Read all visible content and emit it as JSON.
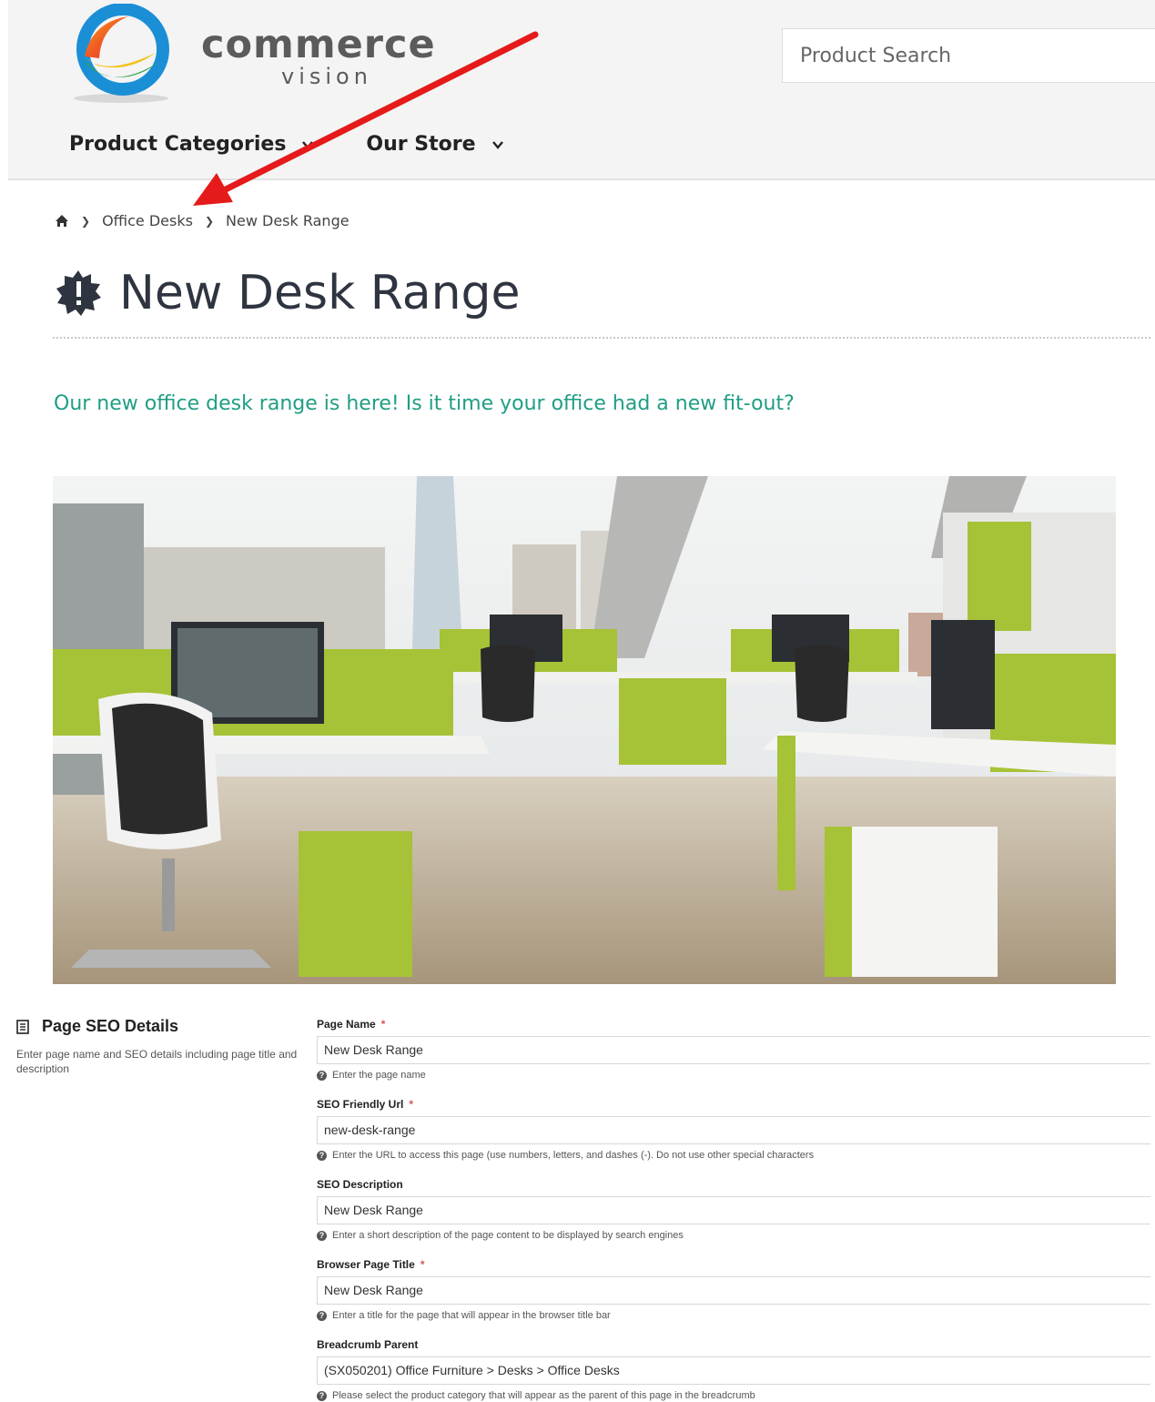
{
  "header": {
    "brand_main": "commerce",
    "brand_sub": "vision",
    "search_placeholder": "Product Search",
    "nav": [
      {
        "label": "Product Categories"
      },
      {
        "label": "Our Store"
      }
    ]
  },
  "breadcrumb": {
    "items": [
      "Office Desks",
      "New Desk Range"
    ]
  },
  "page": {
    "title": "New Desk Range",
    "tagline": "Our new office desk range is here! Is it time your office had a new fit-out?"
  },
  "colors": {
    "accent_green": "#1f9e84",
    "annotation_arrow": "#e51a1a",
    "required": "#d9534f",
    "desk_green": "#a6c236"
  },
  "seo": {
    "heading": "Page SEO Details",
    "description": "Enter page name and SEO details including page title and description",
    "fields": [
      {
        "label": "Page Name",
        "required": true,
        "value": "New Desk Range",
        "help": "Enter the page name"
      },
      {
        "label": "SEO Friendly Url",
        "required": true,
        "value": "new-desk-range",
        "help": "Enter the URL to access this page (use numbers, letters, and dashes (-). Do not use other special characters"
      },
      {
        "label": "SEO Description",
        "required": false,
        "value": "New Desk Range",
        "help": "Enter a short description of the page content to be displayed by search engines"
      },
      {
        "label": "Browser Page Title",
        "required": true,
        "value": "New Desk Range",
        "help": "Enter a title for the page that will appear in the browser title bar"
      },
      {
        "label": "Breadcrumb Parent",
        "required": false,
        "value": "(SX050201) Office Furniture > Desks > Office Desks",
        "help": "Please select the product category that will appear as the parent of this page in the breadcrumb"
      }
    ]
  }
}
